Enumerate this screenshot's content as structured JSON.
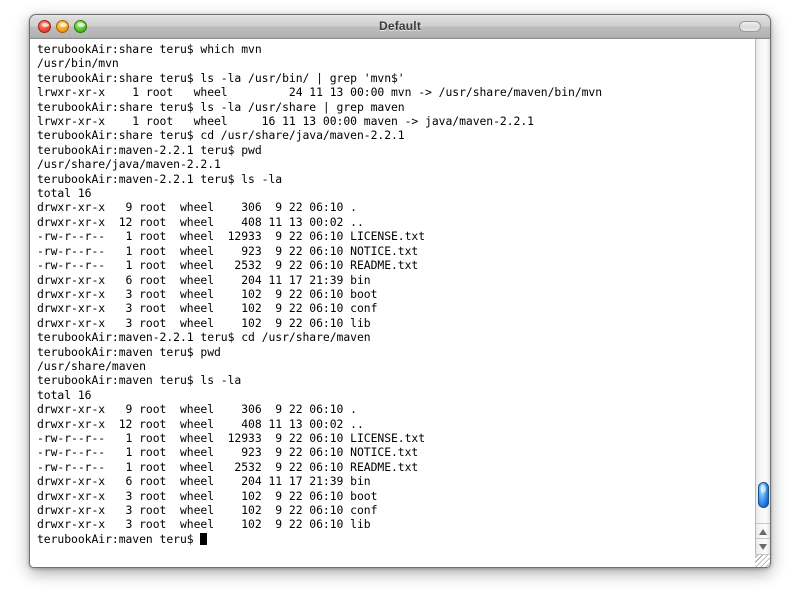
{
  "window": {
    "title": "Default",
    "controls": {
      "close_label": "close",
      "minimize_label": "minimize",
      "zoom_label": "zoom",
      "toolbar_toggle_label": "toggle toolbar"
    }
  },
  "terminal": {
    "prompt_share": "terubookAir:share teru$ ",
    "prompt_maven_ver": "terubookAir:maven-2.2.1 teru$ ",
    "prompt_maven": "terubookAir:maven teru$ ",
    "cursor_visible": true,
    "lines": [
      "terubookAir:share teru$ which mvn",
      "/usr/bin/mvn",
      "terubookAir:share teru$ ls -la /usr/bin/ | grep 'mvn$'",
      "lrwxr-xr-x    1 root   wheel         24 11 13 00:00 mvn -> /usr/share/maven/bin/mvn",
      "terubookAir:share teru$ ls -la /usr/share | grep maven",
      "lrwxr-xr-x    1 root   wheel     16 11 13 00:00 maven -> java/maven-2.2.1",
      "terubookAir:share teru$ cd /usr/share/java/maven-2.2.1",
      "terubookAir:maven-2.2.1 teru$ pwd",
      "/usr/share/java/maven-2.2.1",
      "terubookAir:maven-2.2.1 teru$ ls -la",
      "total 16",
      "drwxr-xr-x   9 root  wheel    306  9 22 06:10 .",
      "drwxr-xr-x  12 root  wheel    408 11 13 00:02 ..",
      "-rw-r--r--   1 root  wheel  12933  9 22 06:10 LICENSE.txt",
      "-rw-r--r--   1 root  wheel    923  9 22 06:10 NOTICE.txt",
      "-rw-r--r--   1 root  wheel   2532  9 22 06:10 README.txt",
      "drwxr-xr-x   6 root  wheel    204 11 17 21:39 bin",
      "drwxr-xr-x   3 root  wheel    102  9 22 06:10 boot",
      "drwxr-xr-x   3 root  wheel    102  9 22 06:10 conf",
      "drwxr-xr-x   3 root  wheel    102  9 22 06:10 lib",
      "terubookAir:maven-2.2.1 teru$ cd /usr/share/maven",
      "terubookAir:maven teru$ pwd",
      "/usr/share/maven",
      "terubookAir:maven teru$ ls -la",
      "total 16",
      "drwxr-xr-x   9 root  wheel    306  9 22 06:10 .",
      "drwxr-xr-x  12 root  wheel    408 11 13 00:02 ..",
      "-rw-r--r--   1 root  wheel  12933  9 22 06:10 LICENSE.txt",
      "-rw-r--r--   1 root  wheel    923  9 22 06:10 NOTICE.txt",
      "-rw-r--r--   1 root  wheel   2532  9 22 06:10 README.txt",
      "drwxr-xr-x   6 root  wheel    204 11 17 21:39 bin",
      "drwxr-xr-x   3 root  wheel    102  9 22 06:10 boot",
      "drwxr-xr-x   3 root  wheel    102  9 22 06:10 conf",
      "drwxr-xr-x   3 root  wheel    102  9 22 06:10 lib"
    ],
    "last_line": "terubookAir:maven teru$ "
  },
  "scrollbar": {
    "up_arrow_glyph": "▲",
    "down_arrow_glyph": "▼"
  },
  "colors": {
    "terminal_background": "#ffffff",
    "terminal_text": "#000000",
    "scroll_thumb_accent": "#1d6fd6",
    "titlebar_text": "#3a3a3a",
    "close_light": "#f4584a",
    "minimize_light": "#f9ab27",
    "zoom_light": "#65cd38"
  }
}
